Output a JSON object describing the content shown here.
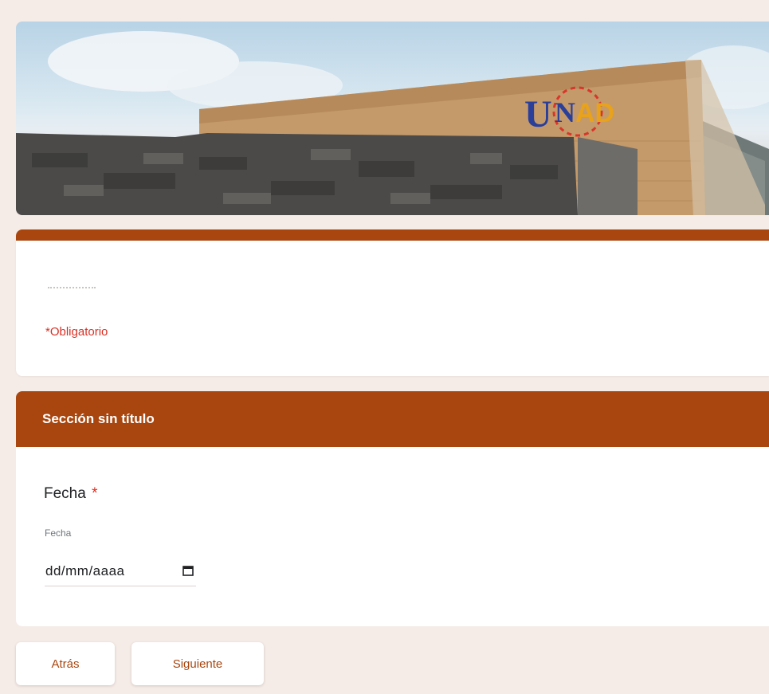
{
  "header": {
    "logo_text": "UNAD"
  },
  "form": {
    "required_note": "*Obligatorio",
    "accent_color": "#a9460f",
    "required_color": "#d93025"
  },
  "section": {
    "title": "Sección sin título"
  },
  "question": {
    "title": "Fecha",
    "required_mark": "*",
    "sublabel": "Fecha",
    "date_placeholder": "dd/mm/aaaa",
    "calendar_icon": "calendar-icon"
  },
  "navigation": {
    "back_label": "Atrás",
    "next_label": "Siguiente"
  }
}
